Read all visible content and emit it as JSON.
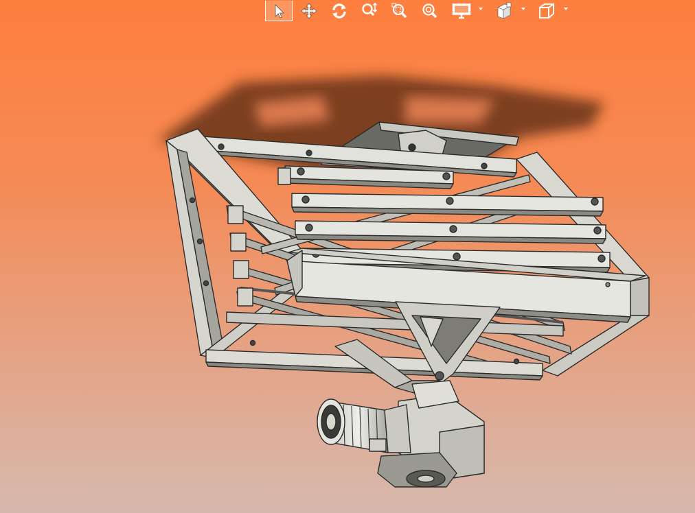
{
  "window": {
    "background_top": "#fe7f3e",
    "background_bottom": "#d6b9ae"
  },
  "toolbar": {
    "buttons": [
      {
        "name": "select-icon",
        "active": true
      },
      {
        "name": "pan-icon",
        "active": false
      },
      {
        "name": "rotate-icon",
        "active": false
      },
      {
        "name": "zoom-dynamic-icon",
        "active": false
      },
      {
        "name": "zoom-window-icon",
        "active": false
      },
      {
        "name": "zoom-fit-icon",
        "active": false
      },
      {
        "name": "display-mode-icon",
        "active": false,
        "has_dropdown": true
      },
      {
        "name": "layers-icon",
        "active": false,
        "has_dropdown": true
      },
      {
        "name": "view-cube-icon",
        "active": false,
        "has_dropdown": true
      }
    ],
    "icon_color": "#ffffff"
  },
  "model": {
    "name": "scissor-lift-mechanism",
    "frame_color": "#d8d8d0",
    "edge_color": "#2b2b2b",
    "shadow_color": "#4a2a18"
  }
}
